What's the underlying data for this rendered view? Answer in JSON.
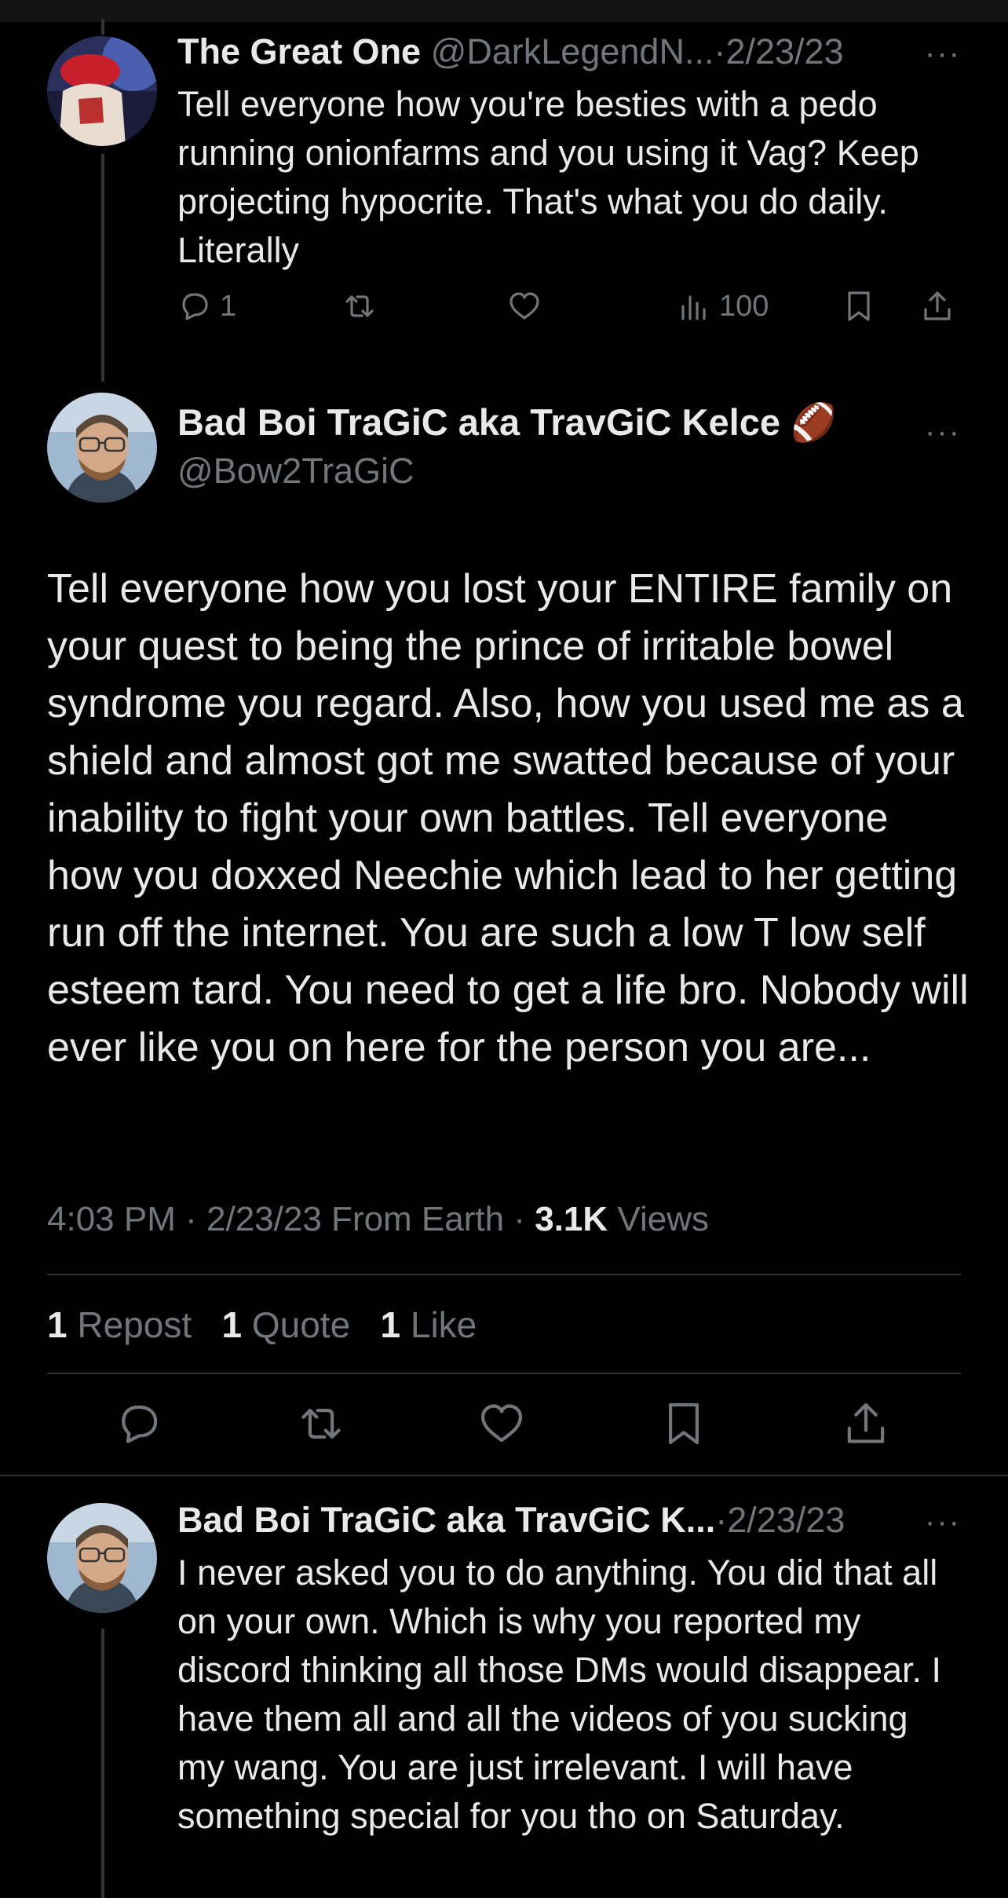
{
  "colors": {
    "background": "#000000",
    "text": "#e7e9ea",
    "muted": "#71767b",
    "divider": "#2f3336"
  },
  "reply1": {
    "author_name": "The Great One",
    "author_handle": "@DarkLegendN...",
    "separator": "·",
    "date": "2/23/23",
    "text": "Tell everyone how you're besties with a pedo running onionfarms and you using it Vag? Keep projecting hypocrite. That's what you do daily. Literally",
    "reply_count": "1",
    "views_count": "100",
    "icons": [
      "reply-icon",
      "repost-icon",
      "like-icon",
      "views-icon",
      "bookmark-icon",
      "share-icon"
    ]
  },
  "main_tweet": {
    "author_name": "Bad Boi TraGiC aka TravGiC Kelce",
    "emoji": "🏈",
    "author_handle": "@Bow2TraGiC",
    "text": "Tell everyone how you lost your ENTIRE family on your quest to being the prince of irritable bowel syndrome you regard. Also, how you used me as a shield and almost got me swatted because of your inability to fight your own battles. Tell everyone how you doxxed Neechie which lead to her getting run off the internet. You are such a low T low self esteem tard. You need to get a life bro. Nobody will ever like you on here for the person you are...",
    "time": "4:03 PM",
    "date": "2/23/23",
    "location": "From Earth",
    "views_value": "3.1K",
    "views_label": "Views",
    "repost_count": "1",
    "repost_label": "Repost",
    "quote_count": "1",
    "quote_label": "Quote",
    "like_count": "1",
    "like_label": "Like"
  },
  "reply2": {
    "author_name": "Bad Boi TraGiC aka TravGiC K...",
    "separator": "·",
    "date": "2/23/23",
    "text": "I never asked you to do anything. You did that all on your own. Which is why you reported my discord thinking all those DMs would disappear. I have them all and all the videos of you sucking my wang. You are just irrelevant. I will have something special for you tho on Saturday."
  },
  "more_label": "···"
}
